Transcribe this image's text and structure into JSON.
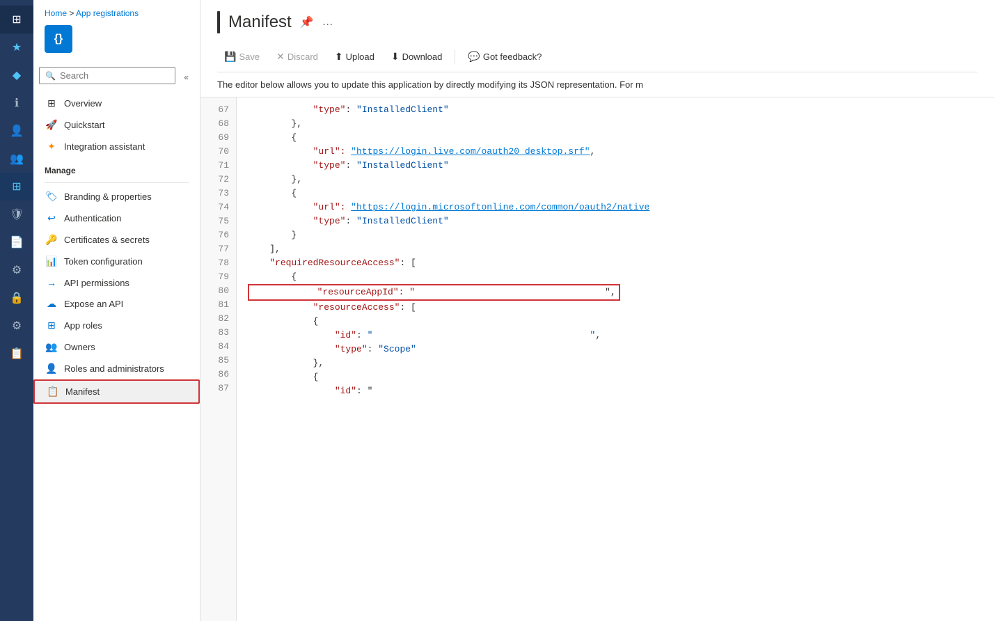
{
  "iconBar": {
    "items": [
      {
        "name": "home-icon",
        "glyph": "⊞",
        "active": false
      },
      {
        "name": "favorites-icon",
        "glyph": "★",
        "active": false
      },
      {
        "name": "diamond-icon",
        "glyph": "◆",
        "active": false
      },
      {
        "name": "info-icon",
        "glyph": "ℹ",
        "active": false
      },
      {
        "name": "user-icon",
        "glyph": "👤",
        "active": false
      },
      {
        "name": "users-icon",
        "glyph": "👥",
        "active": false
      },
      {
        "name": "grid-icon",
        "glyph": "⊞",
        "active": true
      },
      {
        "name": "shield-icon",
        "glyph": "🛡",
        "active": false
      },
      {
        "name": "file-icon",
        "glyph": "📄",
        "active": false
      },
      {
        "name": "gear-icon",
        "glyph": "⚙",
        "active": false
      },
      {
        "name": "lock-icon",
        "glyph": "🔒",
        "active": false
      },
      {
        "name": "settings2-icon",
        "glyph": "⚙",
        "active": false
      },
      {
        "name": "copy-icon",
        "glyph": "📋",
        "active": false
      }
    ]
  },
  "breadcrumb": {
    "home": "Home",
    "separator": " > ",
    "current": "App registrations"
  },
  "appIcon": {
    "label": "{}"
  },
  "search": {
    "placeholder": "Search",
    "collapseLabel": "«"
  },
  "nav": {
    "items": [
      {
        "id": "overview",
        "label": "Overview",
        "icon": "⊞",
        "active": false
      },
      {
        "id": "quickstart",
        "label": "Quickstart",
        "icon": "🚀",
        "active": false
      },
      {
        "id": "integration-assistant",
        "label": "Integration assistant",
        "icon": "✨",
        "active": false
      }
    ],
    "manageLabel": "Manage",
    "manageItems": [
      {
        "id": "branding",
        "label": "Branding & properties",
        "icon": "🏷",
        "active": false
      },
      {
        "id": "authentication",
        "label": "Authentication",
        "icon": "↩",
        "active": false
      },
      {
        "id": "certificates",
        "label": "Certificates & secrets",
        "icon": "🔑",
        "active": false
      },
      {
        "id": "token-config",
        "label": "Token configuration",
        "icon": "📊",
        "active": false
      },
      {
        "id": "api-permissions",
        "label": "API permissions",
        "icon": "→",
        "active": false
      },
      {
        "id": "expose-api",
        "label": "Expose an API",
        "icon": "☁",
        "active": false
      },
      {
        "id": "app-roles",
        "label": "App roles",
        "icon": "⊞",
        "active": false
      },
      {
        "id": "owners",
        "label": "Owners",
        "icon": "👥",
        "active": false
      },
      {
        "id": "roles-admin",
        "label": "Roles and administrators",
        "icon": "👤",
        "active": false
      },
      {
        "id": "manifest",
        "label": "Manifest",
        "icon": "📋",
        "active": true
      }
    ]
  },
  "header": {
    "title": "Manifest",
    "pinIcon": "📌",
    "moreIcon": "…"
  },
  "toolbar": {
    "save": {
      "label": "Save",
      "icon": "💾",
      "disabled": true
    },
    "discard": {
      "label": "Discard",
      "icon": "✕",
      "disabled": true
    },
    "upload": {
      "label": "Upload",
      "icon": "⬆"
    },
    "download": {
      "label": "Download",
      "icon": "⬇"
    },
    "feedback": {
      "label": "Got feedback?",
      "icon": "💬"
    }
  },
  "description": "The editor below allows you to update this application by directly modifying its JSON representation. For m",
  "code": {
    "lines": [
      {
        "num": "67",
        "content": "            \"type\": \"InstalledClient\"",
        "type": "normal"
      },
      {
        "num": "68",
        "content": "        },",
        "type": "normal"
      },
      {
        "num": "69",
        "content": "        {",
        "type": "normal"
      },
      {
        "num": "70",
        "content": "            \"url\": \"https://login.live.com/oauth20_desktop.srf\",",
        "type": "url",
        "keyPart": "\"url\": ",
        "urlPart": "https://login.live.com/oauth20_desktop.srf",
        "afterUrl": "\","
      },
      {
        "num": "71",
        "content": "            \"type\": \"InstalledClient\"",
        "type": "normal"
      },
      {
        "num": "72",
        "content": "        },",
        "type": "normal"
      },
      {
        "num": "73",
        "content": "        {",
        "type": "normal"
      },
      {
        "num": "74",
        "content": "            \"url\": \"https://login.microsoftonline.com/common/oauth2/native",
        "type": "url-truncated",
        "keyPart": "\"url\": ",
        "urlPart": "https://login.microsoftonline.com/common/oauth2/native"
      },
      {
        "num": "75",
        "content": "            \"type\": \"InstalledClient\"",
        "type": "normal"
      },
      {
        "num": "76",
        "content": "        }",
        "type": "normal"
      },
      {
        "num": "77",
        "content": "    ],",
        "type": "normal"
      },
      {
        "num": "78",
        "content": "    \"requiredResourceAccess\": [",
        "type": "normal"
      },
      {
        "num": "79",
        "content": "        {",
        "type": "normal"
      },
      {
        "num": "80",
        "content": "            \"resourceAppId\": \"                                   \",",
        "type": "highlighted"
      },
      {
        "num": "81",
        "content": "            \"resourceAccess\": [",
        "type": "normal"
      },
      {
        "num": "82",
        "content": "            {",
        "type": "normal"
      },
      {
        "num": "83",
        "content": "                \"id\": \"                                        \",",
        "type": "normal"
      },
      {
        "num": "84",
        "content": "                \"type\": \"Scope\"",
        "type": "normal"
      },
      {
        "num": "85",
        "content": "            },",
        "type": "normal"
      },
      {
        "num": "86",
        "content": "            {",
        "type": "normal"
      },
      {
        "num": "87",
        "content": "                \"id\": \"",
        "type": "normal"
      }
    ]
  }
}
